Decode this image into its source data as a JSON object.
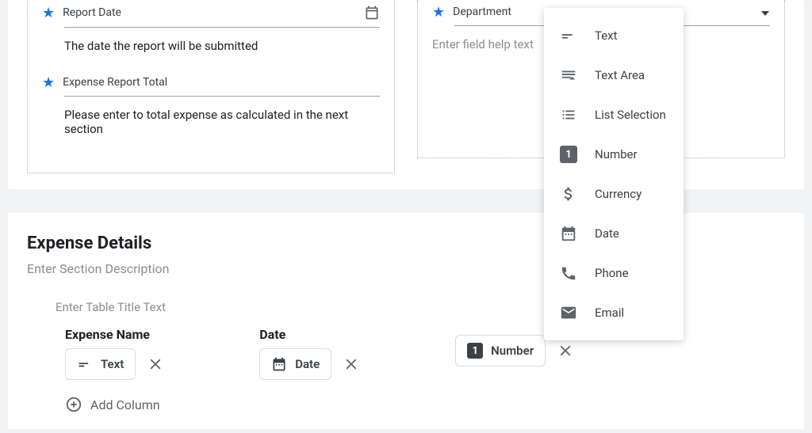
{
  "topFields": {
    "left": [
      {
        "name": "Report Date",
        "help": "The date the report will be submitted",
        "hasCalendar": true
      },
      {
        "name": "Expense Report Total",
        "help": "Please enter to total expense as calculated in the next section",
        "hasCalendar": false
      }
    ],
    "right": [
      {
        "name": "Department",
        "helpPlaceholder": "Enter field help text"
      }
    ]
  },
  "section": {
    "title": "Expense Details",
    "descPlaceholder": "Enter Section Description",
    "tableTitlePlaceholder": "Enter Table Title Text",
    "columns": [
      {
        "name": "Expense Name",
        "typeLabel": "Text",
        "icon": "text"
      },
      {
        "name": "Date",
        "typeLabel": "Date",
        "icon": "date"
      },
      {
        "name": "",
        "typeLabel": "Number",
        "icon": "number"
      }
    ],
    "addColumnLabel": "Add Column"
  },
  "dropdown": {
    "items": [
      {
        "label": "Text",
        "icon": "text"
      },
      {
        "label": "Text Area",
        "icon": "textarea"
      },
      {
        "label": "List Selection",
        "icon": "list"
      },
      {
        "label": "Number",
        "icon": "number"
      },
      {
        "label": "Currency",
        "icon": "currency"
      },
      {
        "label": "Date",
        "icon": "date"
      },
      {
        "label": "Phone",
        "icon": "phone"
      },
      {
        "label": "Email",
        "icon": "email"
      }
    ]
  }
}
